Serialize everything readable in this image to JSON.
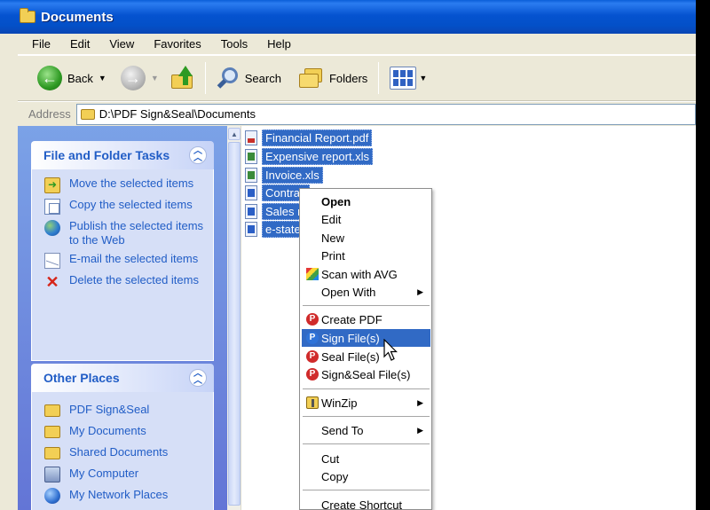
{
  "window": {
    "title": "Documents"
  },
  "menubar": [
    "File",
    "Edit",
    "View",
    "Favorites",
    "Tools",
    "Help"
  ],
  "toolbar": {
    "back_label": "Back",
    "search_label": "Search",
    "folders_label": "Folders"
  },
  "address": {
    "label": "Address",
    "path": "D:\\PDF Sign&Seal\\Documents"
  },
  "tasks_panel": {
    "title": "File and Folder Tasks",
    "items": [
      {
        "label": "Move the selected items",
        "icon": "move-icon"
      },
      {
        "label": "Copy the selected items",
        "icon": "copy-icon"
      },
      {
        "label": "Publish the selected items to the Web",
        "icon": "globe-icon"
      },
      {
        "label": "E-mail the selected items",
        "icon": "email-icon"
      },
      {
        "label": "Delete the selected items",
        "icon": "delete-icon"
      }
    ]
  },
  "places_panel": {
    "title": "Other Places",
    "items": [
      {
        "label": "PDF Sign&Seal",
        "icon": "folder-icon"
      },
      {
        "label": "My Documents",
        "icon": "folder-icon"
      },
      {
        "label": "Shared Documents",
        "icon": "folder-icon"
      },
      {
        "label": "My Computer",
        "icon": "computer-icon"
      },
      {
        "label": "My Network Places",
        "icon": "network-icon"
      }
    ]
  },
  "files": [
    {
      "name": "Financial Report.pdf",
      "type": "pdf"
    },
    {
      "name": "Expensive report.xls",
      "type": "xls"
    },
    {
      "name": "Invoice.xls",
      "type": "xls"
    },
    {
      "name": "Contrac",
      "type": "doc"
    },
    {
      "name": "Sales re",
      "type": "doc"
    },
    {
      "name": "e-state",
      "type": "doc"
    }
  ],
  "context_menu": {
    "open": "Open",
    "edit": "Edit",
    "new": "New",
    "print": "Print",
    "scan_avg": "Scan with AVG",
    "open_with": "Open With",
    "create_pdf": "Create PDF",
    "sign_files": "Sign File(s)",
    "seal_files": "Seal File(s)",
    "sign_seal_files": "Sign&Seal File(s)",
    "winzip": "WinZip",
    "send_to": "Send To",
    "cut": "Cut",
    "copy": "Copy",
    "create_shortcut": "Create Shortcut"
  },
  "colors": {
    "titlebar": "#0553d0",
    "selection": "#316ac5",
    "task_link": "#215dc6"
  }
}
